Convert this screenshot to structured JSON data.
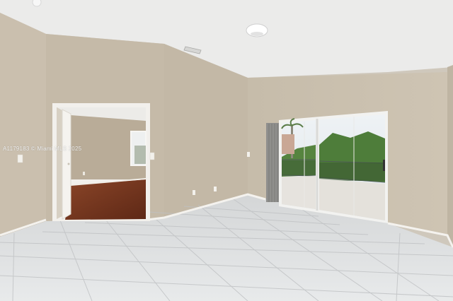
{
  "photo": {
    "watermark": "A1179183 © Miami MLS 2025"
  },
  "colors": {
    "ceiling": "#ebebea",
    "wall_left": "#cabfae",
    "wall_center": "#c3b8a6",
    "wall_right": "#c9bfae",
    "floor": "#dcdedf",
    "wood_floor": "#7a3a22",
    "trim": "#f4f2ee",
    "glass_patio": "#e4e1db",
    "foliage": "#4e7d3a"
  }
}
